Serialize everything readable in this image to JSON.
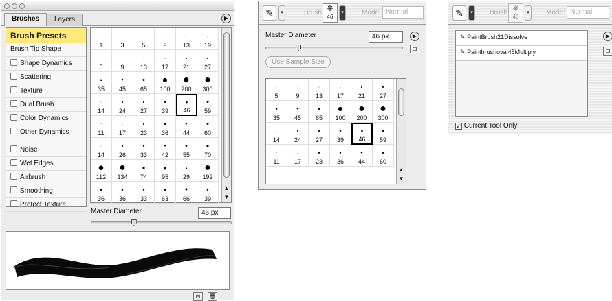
{
  "panel1": {
    "tabs": [
      "Brushes",
      "Layers"
    ],
    "presets_label": "Brush Presets",
    "options": [
      "Brush Tip Shape",
      "Shape Dynamics",
      "Scattering",
      "Texture",
      "Dual Brush",
      "Color Dynamics",
      "Other Dynamics",
      "Noise",
      "Wet Edges",
      "Airbrush",
      "Smoothing",
      "Protect Texture"
    ],
    "brush_sizes": [
      "1",
      "3",
      "5",
      "9",
      "13",
      "19",
      "5",
      "9",
      "13",
      "17",
      "21",
      "27",
      "35",
      "45",
      "65",
      "100",
      "200",
      "300",
      "14",
      "24",
      "27",
      "39",
      "46",
      "59",
      "11",
      "17",
      "23",
      "36",
      "44",
      "60",
      "14",
      "26",
      "33",
      "42",
      "55",
      "70",
      "112",
      "134",
      "74",
      "95",
      "29",
      "192",
      "36",
      "36",
      "33",
      "63",
      "66",
      "39"
    ],
    "selected_size": "46",
    "master_diameter_label": "Master Diameter",
    "master_diameter_value": "46 px",
    "diameter_fraction": 0.09
  },
  "panel2": {
    "brush_label": "Brush:",
    "brush_value": "46",
    "mode_label": "Mode:",
    "mode_value": "Normal",
    "master_diameter_label": "Master Diameter",
    "master_diameter_value": "46 px",
    "use_sample_size": "Use Sample Size",
    "brush_sizes": [
      "5",
      "9",
      "13",
      "17",
      "21",
      "27",
      "35",
      "45",
      "65",
      "100",
      "200",
      "300",
      "14",
      "24",
      "27",
      "39",
      "46",
      "59",
      "11",
      "17",
      "23",
      "36",
      "44",
      "60"
    ],
    "selected_size": "46"
  },
  "panel3": {
    "brush_label": "Brush:",
    "brush_value": "46",
    "mode_label": "Mode:",
    "mode_value": "Normal",
    "presets": [
      "PaintBrush21Dissolve",
      "Paintbrushoval45Multiply"
    ],
    "current_tool_only": "Current Tool Only"
  }
}
